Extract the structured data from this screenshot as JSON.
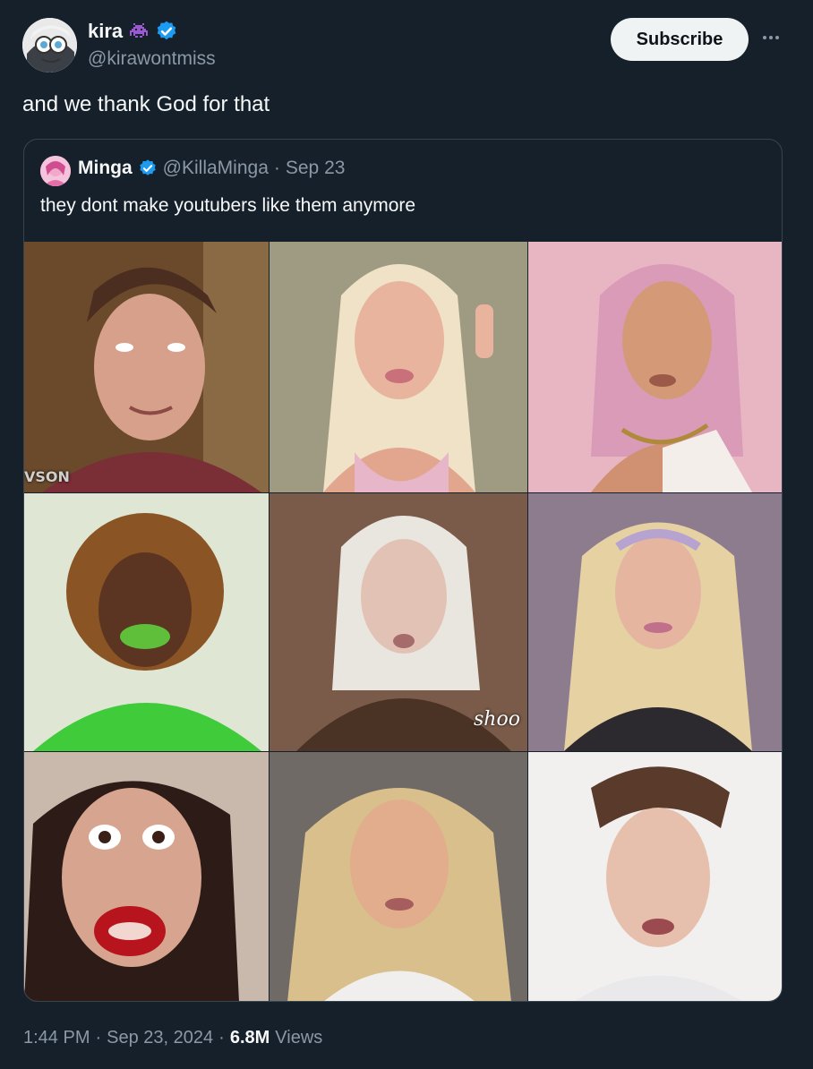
{
  "post": {
    "author_name": "kira",
    "author_handle": "@kirawontmiss",
    "emoji_icon": "space-invader-icon",
    "subscribe_label": "Subscribe",
    "text": "and we thank God for that",
    "time": "1:44 PM",
    "sep1": "·",
    "date": "Sep 23, 2024",
    "sep2": "·",
    "views_count": "6.8M",
    "views_label": "Views"
  },
  "quote": {
    "author_name": "Minga",
    "author_handle": "@KillaMinga",
    "sep": "·",
    "date": "Sep 23",
    "text": "they dont make youtubers like them anymore",
    "image_overlays": {
      "watermark": "VSON",
      "caption": "shoo"
    }
  },
  "colors": {
    "background": "#15202b",
    "text_primary": "#f7f9f9",
    "text_secondary": "#8b98a5",
    "verified": "#1d9bf0",
    "border": "#38444d"
  }
}
